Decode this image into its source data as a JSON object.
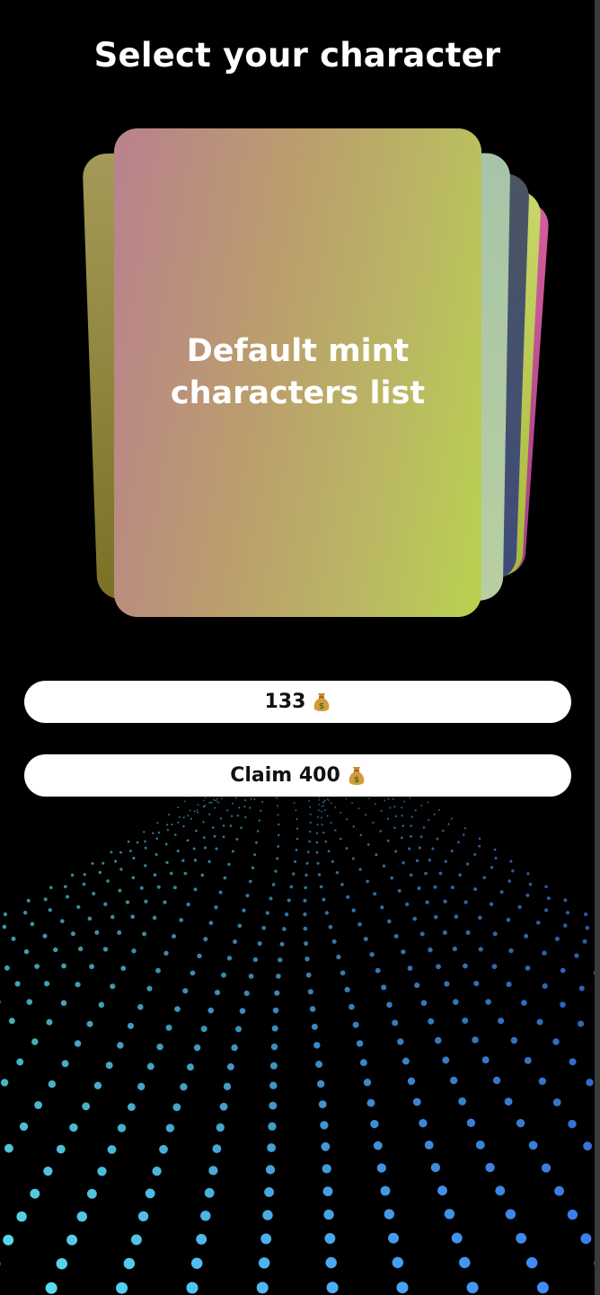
{
  "header": {
    "title": "Select your character"
  },
  "card": {
    "label": "Default mint characters list"
  },
  "balance": {
    "amount": "133",
    "icon": "money-bag-icon"
  },
  "claim": {
    "label": "Claim 400",
    "icon": "money-bag-icon"
  },
  "colors": {
    "background": "#000000",
    "dots_cyan": "#5ce6f5",
    "dots_blue": "#3d7bff",
    "button_bg": "#ffffff"
  }
}
